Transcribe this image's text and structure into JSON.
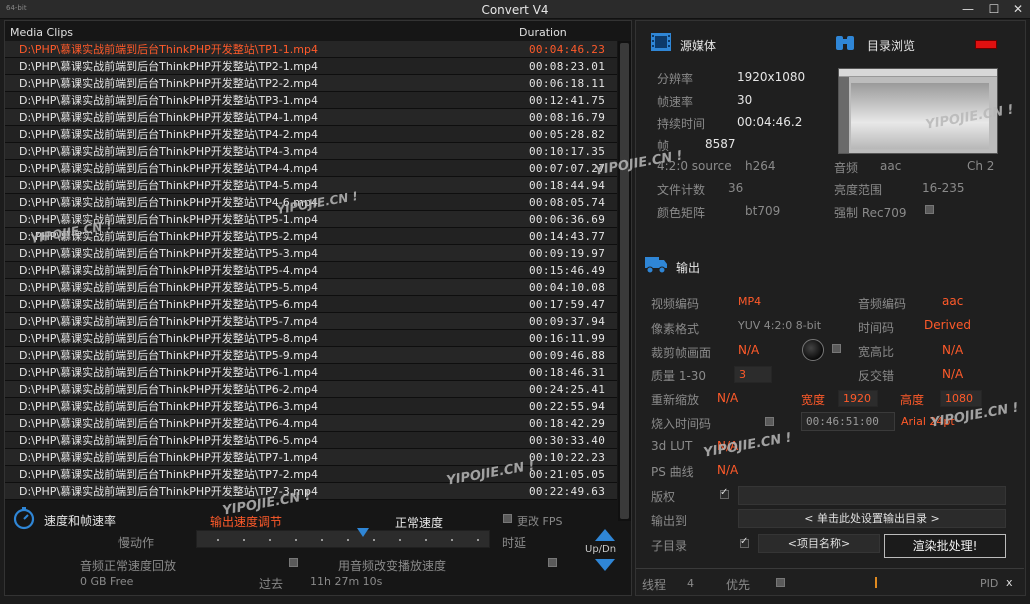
{
  "window": {
    "small_label": "64-bit",
    "title": "Convert V4",
    "minimize": "—",
    "maximize": "☐",
    "close": "✕"
  },
  "clips": {
    "header_name": "Media Clips",
    "header_duration": "Duration",
    "items": [
      {
        "path": "D:\\PHP\\慕课实战前端到后台ThinkPHP开发整站\\TP1-1.mp4",
        "duration": "00:04:46.23"
      },
      {
        "path": "D:\\PHP\\慕课实战前端到后台ThinkPHP开发整站\\TP2-1.mp4",
        "duration": "00:08:23.01"
      },
      {
        "path": "D:\\PHP\\慕课实战前端到后台ThinkPHP开发整站\\TP2-2.mp4",
        "duration": "00:06:18.11"
      },
      {
        "path": "D:\\PHP\\慕课实战前端到后台ThinkPHP开发整站\\TP3-1.mp4",
        "duration": "00:12:41.75"
      },
      {
        "path": "D:\\PHP\\慕课实战前端到后台ThinkPHP开发整站\\TP4-1.mp4",
        "duration": "00:08:16.79"
      },
      {
        "path": "D:\\PHP\\慕课实战前端到后台ThinkPHP开发整站\\TP4-2.mp4",
        "duration": "00:05:28.82"
      },
      {
        "path": "D:\\PHP\\慕课实战前端到后台ThinkPHP开发整站\\TP4-3.mp4",
        "duration": "00:10:17.35"
      },
      {
        "path": "D:\\PHP\\慕课实战前端到后台ThinkPHP开发整站\\TP4-4.mp4",
        "duration": "00:07:07.27"
      },
      {
        "path": "D:\\PHP\\慕课实战前端到后台ThinkPHP开发整站\\TP4-5.mp4",
        "duration": "00:18:44.94"
      },
      {
        "path": "D:\\PHP\\慕课实战前端到后台ThinkPHP开发整站\\TP4-6.mp4",
        "duration": "00:08:05.74"
      },
      {
        "path": "D:\\PHP\\慕课实战前端到后台ThinkPHP开发整站\\TP5-1.mp4",
        "duration": "00:06:36.69"
      },
      {
        "path": "D:\\PHP\\慕课实战前端到后台ThinkPHP开发整站\\TP5-2.mp4",
        "duration": "00:14:43.77"
      },
      {
        "path": "D:\\PHP\\慕课实战前端到后台ThinkPHP开发整站\\TP5-3.mp4",
        "duration": "00:09:19.97"
      },
      {
        "path": "D:\\PHP\\慕课实战前端到后台ThinkPHP开发整站\\TP5-4.mp4",
        "duration": "00:15:46.49"
      },
      {
        "path": "D:\\PHP\\慕课实战前端到后台ThinkPHP开发整站\\TP5-5.mp4",
        "duration": "00:04:10.08"
      },
      {
        "path": "D:\\PHP\\慕课实战前端到后台ThinkPHP开发整站\\TP5-6.mp4",
        "duration": "00:17:59.47"
      },
      {
        "path": "D:\\PHP\\慕课实战前端到后台ThinkPHP开发整站\\TP5-7.mp4",
        "duration": "00:09:37.94"
      },
      {
        "path": "D:\\PHP\\慕课实战前端到后台ThinkPHP开发整站\\TP5-8.mp4",
        "duration": "00:16:11.99"
      },
      {
        "path": "D:\\PHP\\慕课实战前端到后台ThinkPHP开发整站\\TP5-9.mp4",
        "duration": "00:09:46.88"
      },
      {
        "path": "D:\\PHP\\慕课实战前端到后台ThinkPHP开发整站\\TP6-1.mp4",
        "duration": "00:18:46.31"
      },
      {
        "path": "D:\\PHP\\慕课实战前端到后台ThinkPHP开发整站\\TP6-2.mp4",
        "duration": "00:24:25.41"
      },
      {
        "path": "D:\\PHP\\慕课实战前端到后台ThinkPHP开发整站\\TP6-3.mp4",
        "duration": "00:22:55.94"
      },
      {
        "path": "D:\\PHP\\慕课实战前端到后台ThinkPHP开发整站\\TP6-4.mp4",
        "duration": "00:18:42.29"
      },
      {
        "path": "D:\\PHP\\慕课实战前端到后台ThinkPHP开发整站\\TP6-5.mp4",
        "duration": "00:30:33.40"
      },
      {
        "path": "D:\\PHP\\慕课实战前端到后台ThinkPHP开发整站\\TP7-1.mp4",
        "duration": "00:10:22.23"
      },
      {
        "path": "D:\\PHP\\慕课实战前端到后台ThinkPHP开发整站\\TP7-2.mp4",
        "duration": "00:21:05.05"
      },
      {
        "path": "D:\\PHP\\慕课实战前端到后台ThinkPHP开发整站\\TP7-3.mp4",
        "duration": "00:22:49.63"
      }
    ]
  },
  "speed": {
    "title": "速度和帧速率",
    "adjust_label": "输出速度调节",
    "normal_label": "正常速度",
    "change_fps": "更改 FPS",
    "slow_label": "慢动作",
    "delay_label": "时延",
    "audio_normal": "音频正常速度回放",
    "audio_pitch": "用音频改变播放速度",
    "disk_free": "0 GB Free",
    "past_label": "过去",
    "elapsed": "11h 27m 10s",
    "updn": "Up/Dn"
  },
  "source": {
    "title": "源媒体",
    "resolution_label": "分辨率",
    "resolution": "1920x1080",
    "fps_label": "帧速率",
    "fps": "30",
    "duration_label": "持续时间",
    "duration": "00:04:46.2",
    "frames_label": "帧",
    "frames": "8587",
    "source_fmt": "4:2:0 source",
    "codec": "h264",
    "file_count_label": "文件计数",
    "file_count": "36",
    "color_matrix_label": "颜色矩阵",
    "color_matrix": "bt709",
    "browse_title": "目录浏览",
    "audio_label": "音频",
    "audio_codec": "aac",
    "channels": "Ch 2",
    "luma_label": "亮度范围",
    "luma": "16-235",
    "force_rec": "强制 Rec709"
  },
  "output": {
    "title": "输出",
    "vcodec_label": "视频编码",
    "vcodec": "MP4",
    "acodec_label": "音频编码",
    "acodec": "aac",
    "pixfmt_label": "像素格式",
    "pixfmt": "YUV 4:2:0 8-bit",
    "timecode_label": "时间码",
    "timecode_val": "Derived",
    "crop_label": "裁剪帧画面",
    "crop": "N/A",
    "aspect_label": "宽高比",
    "aspect": "N/A",
    "quality_label": "质量 1-30",
    "quality": "3",
    "deinterlace_label": "反交错",
    "deinterlace": "N/A",
    "rescale_label": "重新缩放",
    "rescale": "N/A",
    "width_label": "宽度",
    "width": "1920",
    "height_label": "高度",
    "height": "1080",
    "burn_tc_label": "烧入时间码",
    "burn_tc": "00:46:51:00",
    "font": "Arial 24pt",
    "lut_label": "3d LUT",
    "lut": "N/A",
    "ps_curve_label": "PS 曲线",
    "ps_curve": "N/A",
    "copyright_label": "版权",
    "output_to_label": "输出到",
    "output_to": "< 单击此处设置输出目录 >",
    "subdir_label": "子目录",
    "subdir": "<项目名称>",
    "render": "渲染批处理!",
    "threads_label": "线程",
    "threads": "4",
    "priority_label": "优先",
    "pid_label": "PID",
    "pid_x": "x"
  },
  "watermarks": [
    "YIPOJIE.CN !",
    "YIPOJIE.CN !",
    "YIPOJIE.CN !",
    "YIPOJIE.CN !",
    "YIPOJIE.CN !",
    "YIPOJIE.CN !",
    "YIPOJIE.CN !",
    "YIPOJIE.CN !"
  ]
}
